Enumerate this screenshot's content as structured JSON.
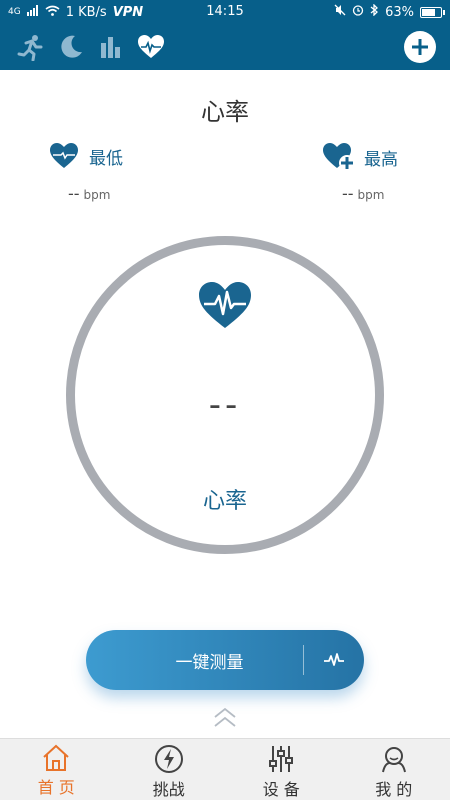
{
  "status_bar": {
    "signal": "4G",
    "speed": "1 KB/s",
    "vpn": "VPN",
    "time": "14:15",
    "battery": "63%"
  },
  "toolbar": {
    "tabs": [
      "run-icon",
      "moon-icon",
      "bar-chart-icon",
      "heart-rate-icon"
    ],
    "active_tab": 3,
    "add_icon": "plus-icon",
    "color": "#075f8a"
  },
  "page": {
    "title": "心率",
    "min_label": "最低",
    "min_value": "--",
    "max_label": "最高",
    "max_value": "--",
    "unit": "bpm",
    "current_value": "--",
    "ring_caption": "心率"
  },
  "measure_button": {
    "label": "一键测量"
  },
  "bottom_nav": {
    "items": [
      {
        "label": "首 页",
        "icon": "home-icon"
      },
      {
        "label": "挑战",
        "icon": "lightning-icon"
      },
      {
        "label": "设 备",
        "icon": "sliders-icon"
      },
      {
        "label": "我 的",
        "icon": "profile-icon"
      }
    ],
    "active": 0,
    "active_color": "#e8732a"
  }
}
